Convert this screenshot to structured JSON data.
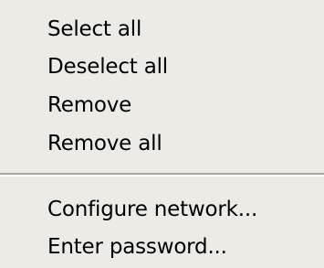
{
  "menu": {
    "group_1": [
      {
        "label": "Select all"
      },
      {
        "label": "Deselect all"
      },
      {
        "label": "Remove"
      },
      {
        "label": "Remove all"
      }
    ],
    "group_2": [
      {
        "label": "Configure network..."
      },
      {
        "label": "Enter password..."
      }
    ]
  },
  "colors": {
    "menu_background": "#ecebe6",
    "text": "#000000",
    "separator_shadow": "#a8a7a2",
    "separator_highlight": "#ffffff"
  }
}
